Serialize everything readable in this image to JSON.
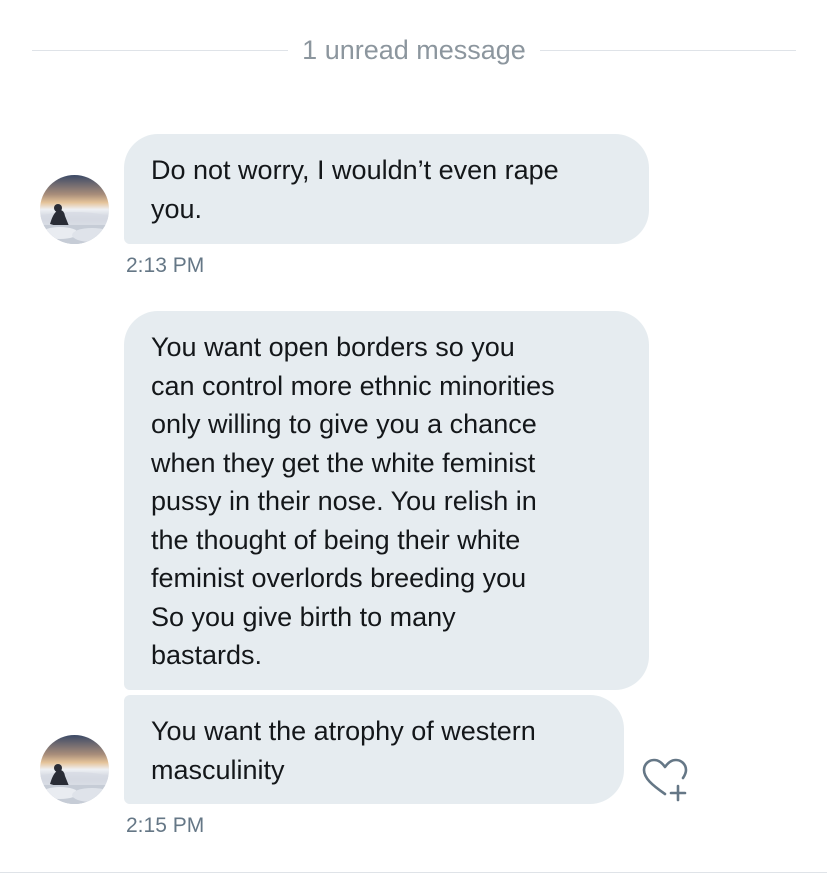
{
  "conversation": {
    "unread_divider": "1 unread message",
    "messages": [
      {
        "text": "Do not worry, I wouldn’t even rape\nyou.",
        "timestamp": "2:13 PM"
      },
      {
        "text": "You want open borders so you\ncan control more ethnic minorities\nonly willing to give you a chance\nwhen they get the white feminist\npussy in their nose. You relish in\nthe thought of being their white\nfeminist overlords breeding you\nSo you give birth to many\nbastards."
      },
      {
        "text": "You want the atrophy of western\nmasculinity",
        "timestamp": "2:15 PM"
      }
    ],
    "bubble_color": "#e6ecf0",
    "timestamp_color": "#657786",
    "like_icon": "heart-plus-icon"
  }
}
